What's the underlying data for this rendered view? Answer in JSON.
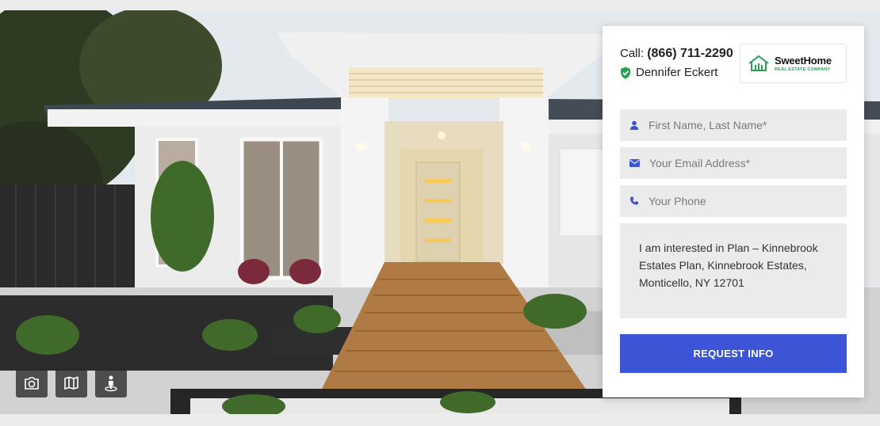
{
  "contact": {
    "call_label": "Call:",
    "phone": "(866) 711-2290",
    "agent_name": "Dennifer Eckert"
  },
  "logo": {
    "brand": "SweetHome",
    "tagline": "REAL ESTATE COMPANY"
  },
  "form": {
    "name_placeholder": "First Name, Last Name*",
    "email_placeholder": "Your Email Address*",
    "phone_placeholder": "Your Phone",
    "message": "I am interested in Plan – Kinnebrook Estates Plan, Kinnebrook Estates, Monticello, NY 12701",
    "submit_label": "REQUEST INFO"
  },
  "media_buttons": [
    {
      "icon": "camera-icon"
    },
    {
      "icon": "map-icon"
    },
    {
      "icon": "street-view-icon"
    }
  ],
  "colors": {
    "accent": "#3b55d6",
    "verified": "#2aa052",
    "field_bg": "#ebebeb"
  }
}
